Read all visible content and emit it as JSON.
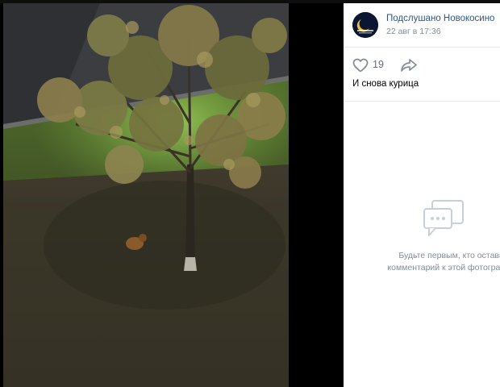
{
  "post": {
    "author": "Подслушано Новокосино",
    "date": "22 авг в 17:36",
    "likes": "19",
    "caption": "И снова курица"
  },
  "comments": {
    "empty_line1": "Будьте первым, кто оставит",
    "empty_line2": "комментарий к этой фотографии."
  },
  "icons": {
    "like": "heart-outline-icon",
    "share": "share-arrow-icon",
    "comments": "chat-bubble-icon"
  },
  "colors": {
    "author_link": "#2a5885",
    "muted_text": "#818c99",
    "icon_gray": "#818c99"
  }
}
